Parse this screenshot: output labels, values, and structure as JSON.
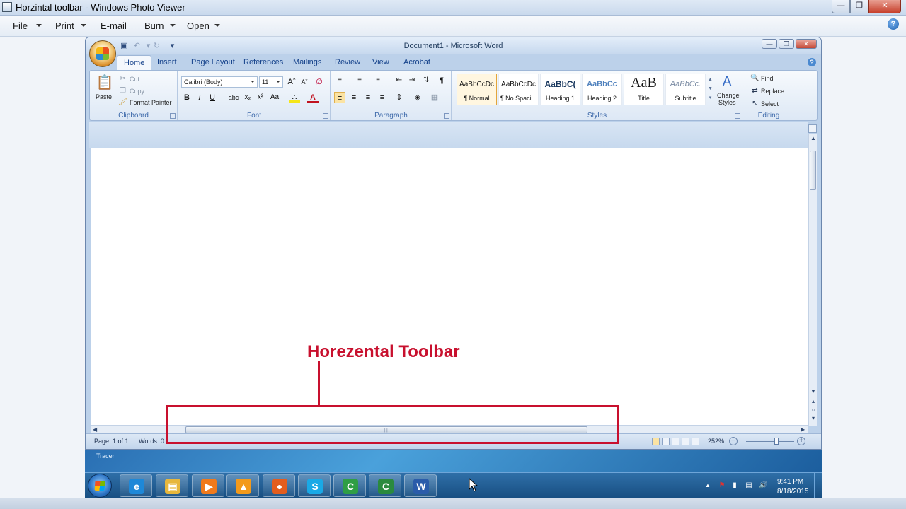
{
  "viewer": {
    "title": "Horzintal toolbar - Windows Photo Viewer",
    "menu": {
      "file": "File",
      "print": "Print",
      "email": "E-mail",
      "burn": "Burn",
      "open": "Open"
    },
    "help": "?"
  },
  "word": {
    "title": "Document1 - Microsoft Word",
    "tabs": [
      "Home",
      "Insert",
      "Page Layout",
      "References",
      "Mailings",
      "Review",
      "View",
      "Acrobat"
    ],
    "clipboard": {
      "paste": "Paste",
      "cut": "Cut",
      "copy": "Copy",
      "format_painter": "Format Painter",
      "label": "Clipboard"
    },
    "font": {
      "name": "Calibri (Body)",
      "size": "11",
      "label": "Font"
    },
    "paragraph": {
      "label": "Paragraph"
    },
    "styles": {
      "items": [
        {
          "sample": "AaBbCcDc",
          "name": "¶ Normal"
        },
        {
          "sample": "AaBbCcDc",
          "name": "¶ No Spaci..."
        },
        {
          "sample": "AaBbC(",
          "name": "Heading 1"
        },
        {
          "sample": "AaBbCc",
          "name": "Heading 2"
        },
        {
          "sample": "AaB",
          "name": "Title"
        },
        {
          "sample": "AaBbCc.",
          "name": "Subtitle"
        }
      ],
      "change_styles_1": "Change",
      "change_styles_2": "Styles",
      "label": "Styles"
    },
    "editing": {
      "find": "Find",
      "replace": "Replace",
      "select": "Select",
      "label": "Editing"
    },
    "status": {
      "page": "Page: 1 of 1",
      "words": "Words: 0",
      "zoom": "252%"
    }
  },
  "annotation": {
    "label": "Horezental Toolbar"
  },
  "taskbar": {
    "strip_text": "Tracer",
    "time": "9:41 PM",
    "date": "8/18/2015",
    "apps": [
      {
        "icon": "internet-explorer-icon",
        "color": "#1e88d8"
      },
      {
        "icon": "folder-icon",
        "color": "#e7b73c"
      },
      {
        "icon": "media-player-icon",
        "color": "#f07a1c"
      },
      {
        "icon": "vlc-icon",
        "color": "#f39a1b"
      },
      {
        "icon": "firefox-icon",
        "color": "#e35d1e"
      },
      {
        "icon": "skype-icon",
        "color": "#19a9e6"
      },
      {
        "icon": "camtasia-icon",
        "color": "#2f9e45"
      },
      {
        "icon": "camtasia-recorder-icon",
        "color": "#2a8a3e"
      },
      {
        "icon": "word-icon",
        "color": "#2b5caa"
      }
    ]
  }
}
